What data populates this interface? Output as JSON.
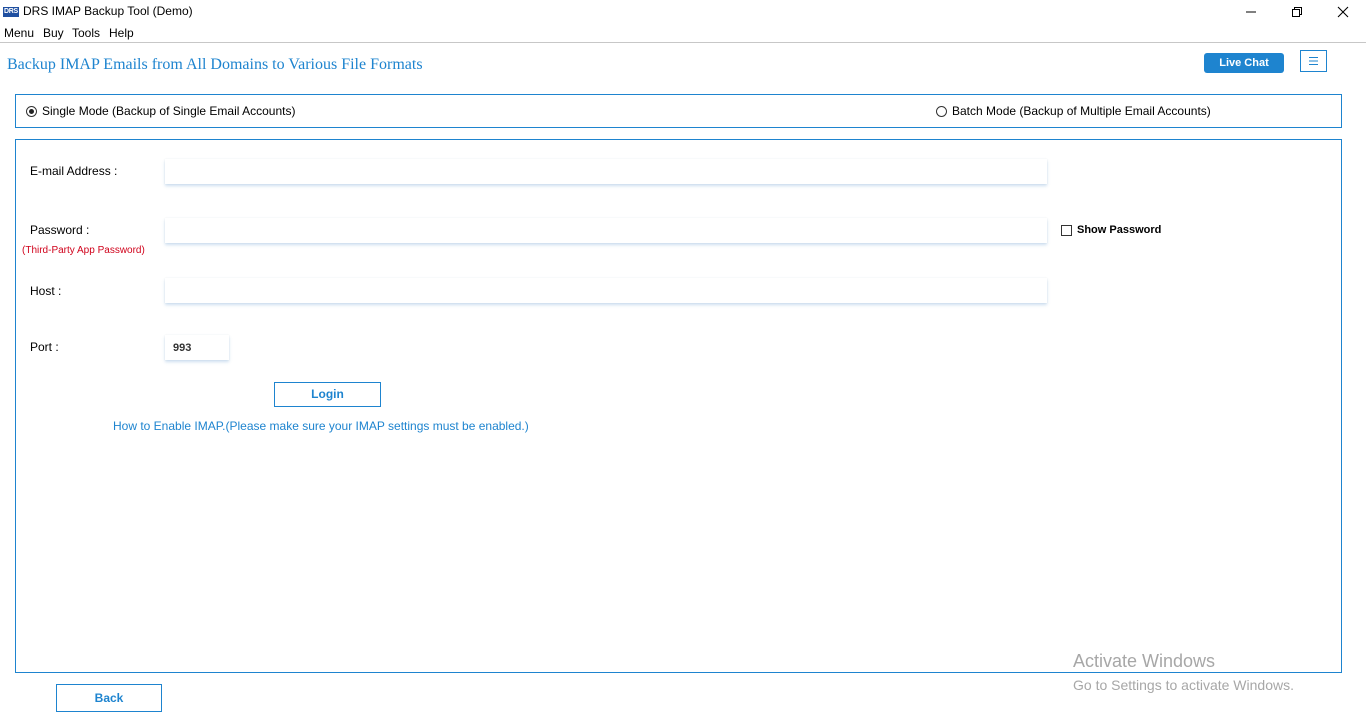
{
  "window": {
    "logo_text": "DRS",
    "title": "DRS IMAP Backup Tool (Demo)",
    "icons": {
      "minimize": "minimize-icon",
      "maximize": "restore-icon",
      "close": "close-icon"
    }
  },
  "menubar": {
    "items": [
      "Menu",
      "Buy",
      "Tools",
      "Help"
    ]
  },
  "header": {
    "title": "Backup IMAP Emails from All Domains to Various File Formats",
    "live_chat_label": "Live Chat",
    "menu_icon": "hamburger-icon",
    "accent_color": "#1e84cf"
  },
  "mode": {
    "single_label": "Single Mode (Backup of Single Email Accounts)",
    "batch_label": "Batch Mode (Backup of Multiple Email Accounts)",
    "selected": "single"
  },
  "form": {
    "email_label": "E-mail Address :",
    "email_value": "",
    "password_label": "Password :",
    "password_hint": "(Third-Party App Password)",
    "password_value": "",
    "show_password_label": "Show Password",
    "show_password_checked": false,
    "host_label": "Host :",
    "host_value": "",
    "port_label": "Port :",
    "port_value": "993",
    "login_label": "Login",
    "imap_help_text": "How to Enable IMAP.(Please make sure your IMAP settings must be enabled.)"
  },
  "footer": {
    "back_label": "Back"
  },
  "watermark": {
    "title": "Activate Windows",
    "subtitle": "Go to Settings to activate Windows."
  }
}
